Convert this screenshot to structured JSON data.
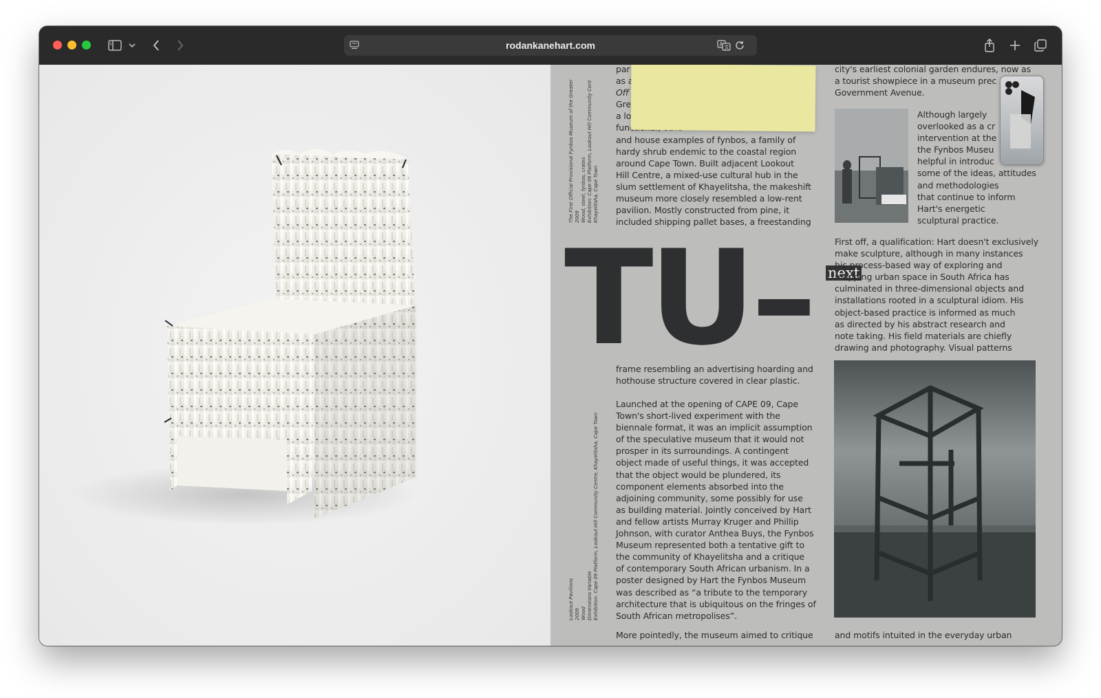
{
  "browser": {
    "url": "rodankanehart.com"
  },
  "article": {
    "col_a_top": [
      "par",
      "as a",
      "Off",
      "Gre",
      "a lo",
      "functional, othe",
      "and house examples of fynbos, a family of",
      "hardy shrub endemic to the coastal region",
      "around Cape Town. Built adjacent Lookout",
      "Hill Centre, a mixed-use cultural hub in the",
      "slum settlement of Khayelitsha, the makeshift",
      "museum more closely resembled a low-rent",
      "pavilion. Mostly constructed from pine, it",
      "included shipping pallet bases, a freestanding"
    ],
    "col_b_top": [
      "city's earliest colonial garden endures, now as",
      "a tourist showpiece in a museum prec",
      "Government Avenue."
    ],
    "col_b_side": [
      "Although largely",
      "overlooked as a cr",
      "intervention at the",
      "the Fynbos Museu",
      "helpful in introduc",
      "some of the ideas, attitudes",
      "and methodologies",
      "that continue to inform",
      "Hart's energetic",
      "sculptural practice."
    ],
    "col_b_mid": [
      "First off, a qualification: Hart doesn't exclusively",
      "make sculpture, although in many instances",
      "his process-based way of exploring and",
      "mapping urban space in South Africa has",
      "culminated in three-dimensional objects and",
      "installations rooted in a sculptural idiom. His",
      "object-based practice is informed as much",
      "as directed by his abstract research and",
      "note taking. His field materials are chiefly",
      "drawing and photography. Visual patterns"
    ],
    "col_a_mid": [
      "frame resembling an advertising hoarding and",
      "hothouse structure covered in clear plastic."
    ],
    "col_a_bottom": [
      "Launched at the opening of CAPE 09, Cape",
      "Town's short-lived experiment with the",
      "biennale format, it was an implicit assumption",
      "of the speculative museum that it would not",
      "prosper in its surroundings. A contingent",
      "object made of useful things, it was accepted",
      "that the object would be plundered, its",
      "component elements absorbed into the",
      "adjoining community, some possibly for use",
      "as building material. Jointly conceived by Hart",
      "and fellow artists Murray Kruger and Phillip",
      "Johnson, with curator Anthea Buys, the Fynbos",
      "Museum represented both a tentative gift to",
      "the community of Khayelitsha and a critique",
      "of contemporary South African urbanism. In a",
      "poster designed by Hart the Fynbos Museum",
      "was described as “a tribute to the temporary",
      "architecture that is ubiquitous on the fringes of",
      "South African metropolises”."
    ],
    "col_a_cut": "More pointedly, the museum aimed to critique",
    "col_b_cut": "and motifs intuited in the everyday urban",
    "headline": "TU–",
    "next_label": "next",
    "caption_top": [
      "The First Official Provisional Fynbos Museum of the Greater",
      "2009",
      "Wood, steel, fynbos, crates",
      "Exhibition: Cape 09 Platform, Lookout Hill Community Cent",
      "Khayelitsha, Cape Town"
    ],
    "caption_bottom": [
      "Lookout Pavilions",
      "2009",
      "Wood",
      "Dimensions Variable",
      "Exhibition: Cape 09 Platform, Lookout Hill Community Centre, Khayelitsha, Cape Town"
    ]
  }
}
